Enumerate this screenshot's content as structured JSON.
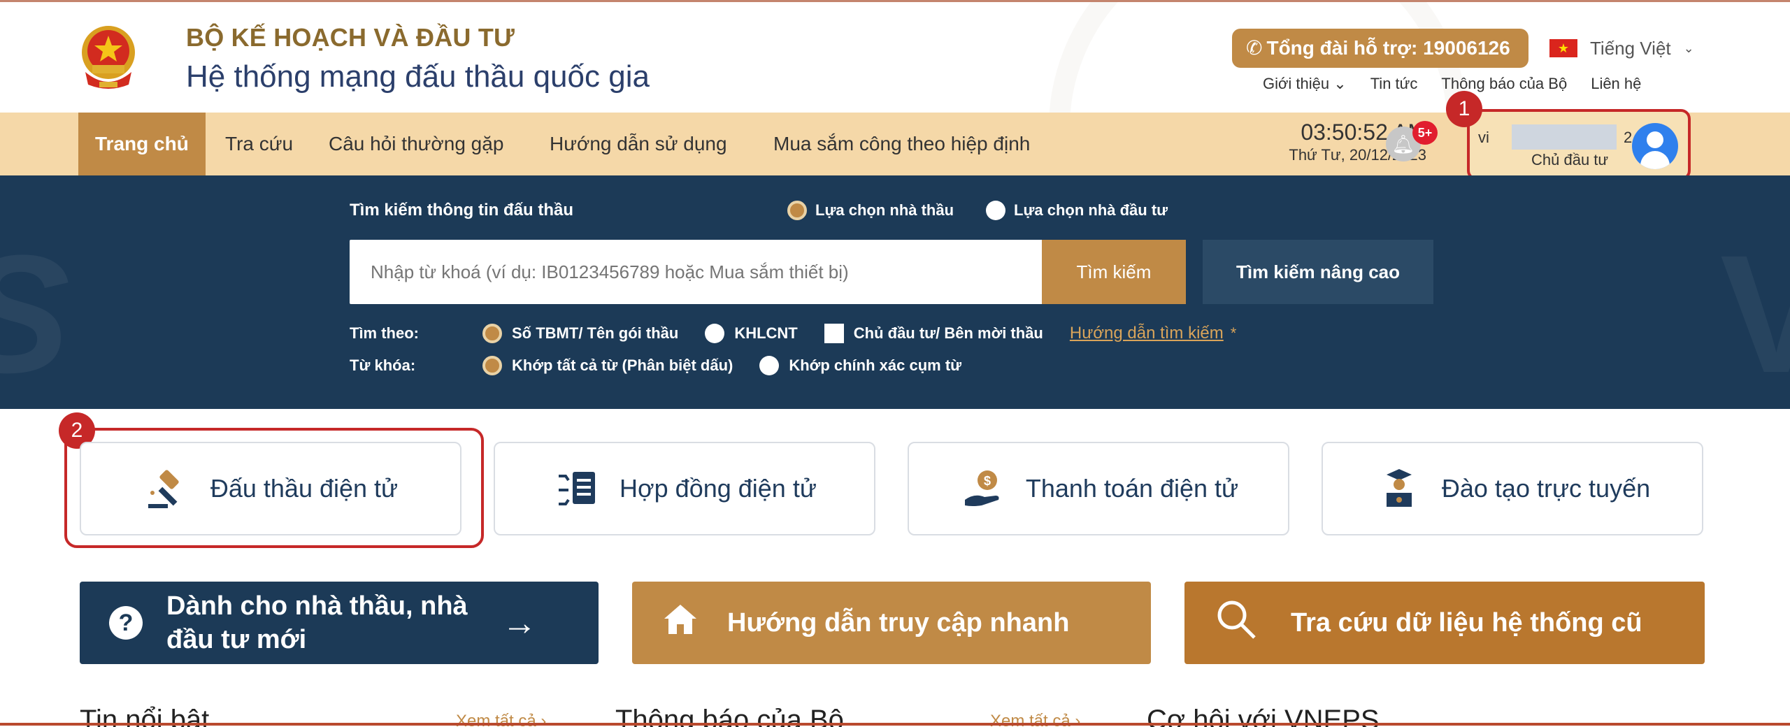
{
  "header": {
    "org_name": "BỘ KẾ HOẠCH VÀ ĐẦU TƯ",
    "system_name": "Hệ thống mạng đấu thầu quốc gia",
    "hotline": "Tổng đài hỗ trợ: 19006126",
    "language": "Tiếng Việt",
    "top_links": [
      "Giới thiệu",
      "Tin tức",
      "Thông báo của Bộ",
      "Liên hệ"
    ]
  },
  "nav": {
    "items": [
      "Trang chủ",
      "Tra cứu",
      "Câu hỏi thường gặp",
      "Hướng dẫn sử dụng",
      "Mua sắm công theo hiệp định"
    ],
    "time": "03:50:52 AM",
    "date": "Thứ Tư, 20/12/2023",
    "notification_badge": "5+",
    "user_prefix": "vi",
    "user_suffix": "2",
    "user_role": "Chủ đầu tư"
  },
  "markers": [
    "1",
    "2"
  ],
  "search": {
    "title": "Tìm kiếm thông tin đấu thầu",
    "mode_options": [
      "Lựa chọn nhà thầu",
      "Lựa chọn nhà đầu tư"
    ],
    "placeholder": "Nhập từ khoá (ví dụ: IB0123456789 hoặc Mua sắm thiết bị)",
    "search_button": "Tìm kiếm",
    "advanced_button": "Tìm kiếm nâng cao",
    "search_by_label": "Tìm theo:",
    "search_by_options": [
      "Số TBMT/ Tên gói thầu",
      "KHLCNT",
      "Chủ đầu tư/ Bên mời thầu"
    ],
    "guide_link": "Hướng dẫn tìm kiếm",
    "guide_star": "*",
    "keyword_label": "Từ khóa:",
    "keyword_options": [
      "Khớp tất cả từ (Phân biệt dấu)",
      "Khớp chính xác cụm từ"
    ]
  },
  "services": [
    "Đấu thầu điện tử",
    "Hợp đồng điện tử",
    "Thanh toán điện tử",
    "Đào tạo trực tuyến"
  ],
  "actions": {
    "new_bidders_line1": "Dành cho nhà thầu, nhà",
    "new_bidders_line2": "đầu tư mới",
    "quick_access": "Hướng dẫn truy cập nhanh",
    "legacy_lookup": "Tra cứu dữ liệu hệ thống cũ"
  },
  "sections": {
    "featured": "Tin nổi bật",
    "ministry_notices": "Thông báo của Bộ",
    "opportunities": "Cơ hội với VNEPS",
    "view_all": "Xem tất cả"
  },
  "colors": {
    "brand_gold": "#c08a46",
    "brand_navy": "#1c3a57",
    "nav_bg": "#f5d8a8",
    "highlight_red": "#c62828"
  }
}
